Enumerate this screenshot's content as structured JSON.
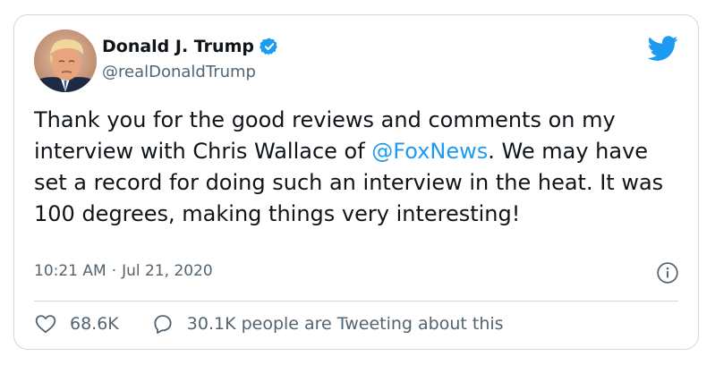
{
  "tweet": {
    "display_name": "Donald J. Trump",
    "handle": "@realDonaldTrump",
    "verified": true,
    "text_before": "Thank you for the good reviews and comments on my interview with Chris Wallace of ",
    "mention": "@FoxNews",
    "text_after": ". We may have set a record for doing such an interview in the heat. It was 100 degrees, making things very interesting!",
    "time": "10:21 AM",
    "separator": "·",
    "date": "Jul 21, 2020",
    "likes": "68.6K",
    "replies_text": "30.1K people are Tweeting about this"
  },
  "icons": {
    "verified": "verified-badge-icon",
    "brand": "twitter-bird-icon",
    "info": "info-icon",
    "like": "heart-icon",
    "reply": "comment-bubble-icon"
  },
  "colors": {
    "accent": "#1d9bf0",
    "text": "#0f1419",
    "secondary": "#536471",
    "border": "#cfd9de"
  }
}
